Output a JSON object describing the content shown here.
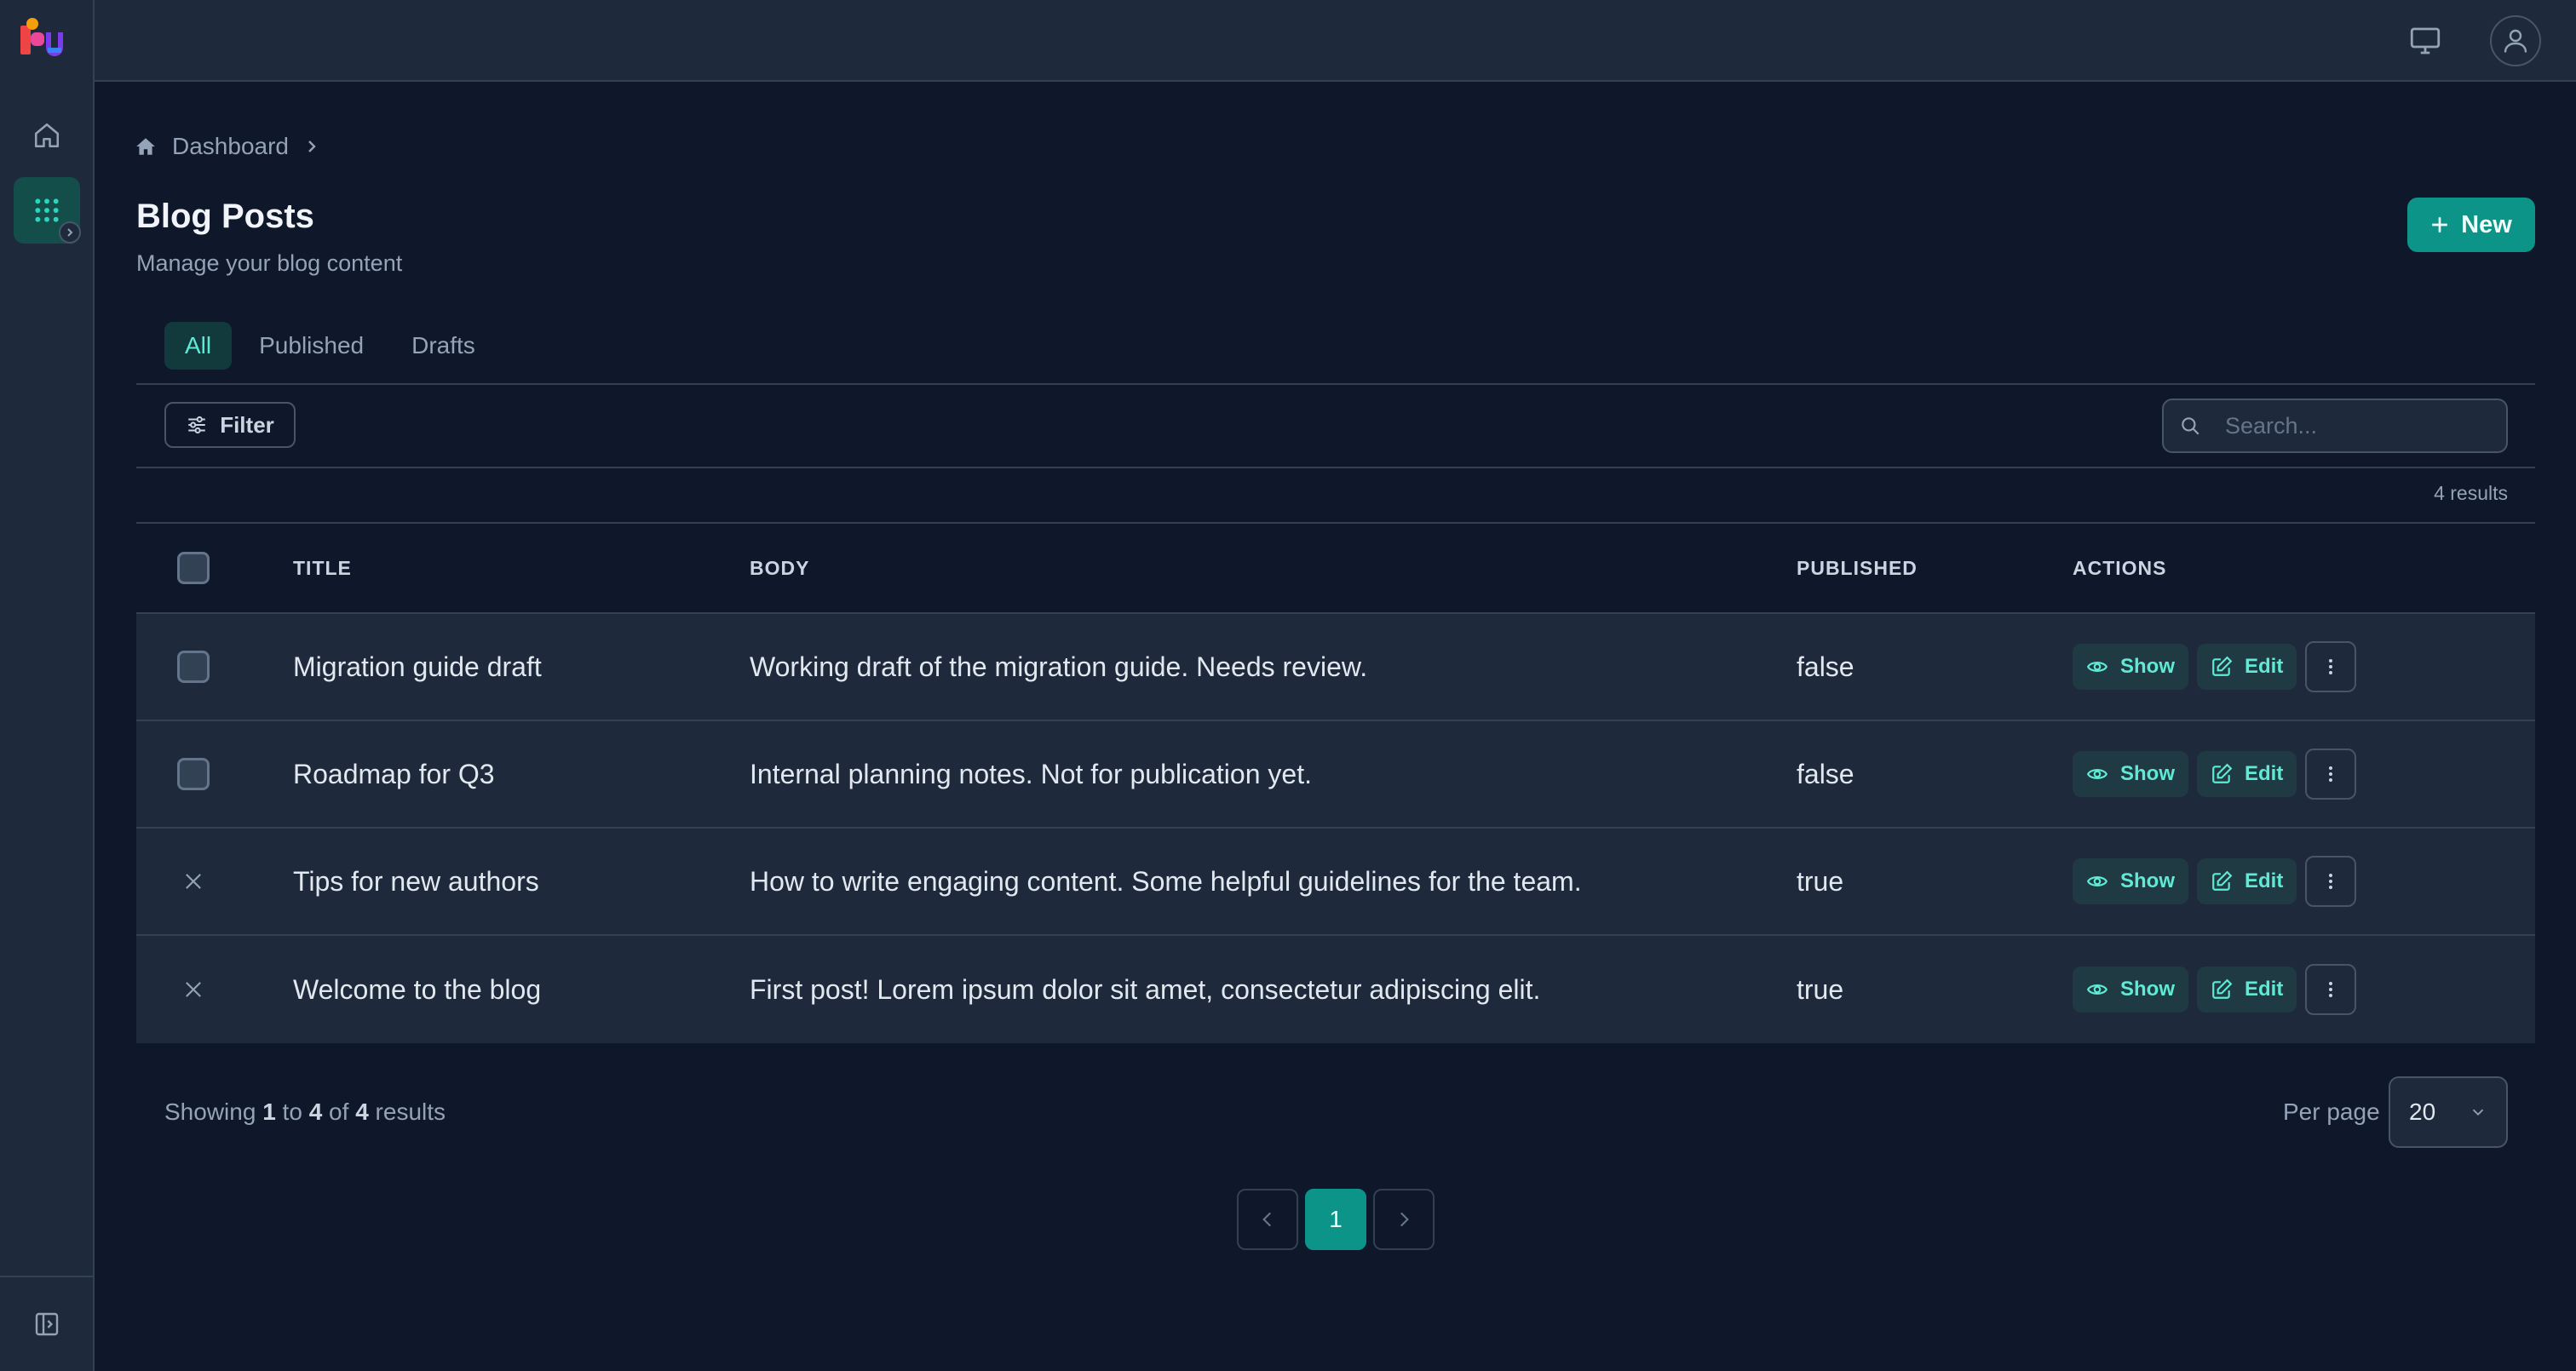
{
  "colors": {
    "accent": "#0d9488",
    "accent_text": "#5eead4",
    "background": "#0f172a",
    "surface": "#1e293b"
  },
  "breadcrumb": {
    "items": [
      "Dashboard"
    ]
  },
  "page": {
    "title": "Blog Posts",
    "subtitle": "Manage your blog content",
    "new_label": "New"
  },
  "tabs": [
    {
      "label": "All",
      "active": true
    },
    {
      "label": "Published",
      "active": false
    },
    {
      "label": "Drafts",
      "active": false
    }
  ],
  "toolbar": {
    "filter_label": "Filter",
    "search_placeholder": "Search...",
    "results_count": "4 results"
  },
  "table": {
    "columns": [
      "TITLE",
      "BODY",
      "PUBLISHED",
      "ACTIONS"
    ],
    "rows": [
      {
        "title": "Migration guide draft",
        "body": "Working draft of the migration guide. Needs review.",
        "published": "false",
        "selector": "checkbox"
      },
      {
        "title": "Roadmap for Q3",
        "body": "Internal planning notes. Not for publication yet.",
        "published": "false",
        "selector": "checkbox"
      },
      {
        "title": "Tips for new authors",
        "body": "How to write engaging content. Some helpful guidelines for the team.",
        "published": "true",
        "selector": "x-icon"
      },
      {
        "title": "Welcome to the blog",
        "body": "First post! Lorem ipsum dolor sit amet, consectetur adipiscing elit.",
        "published": "true",
        "selector": "x-icon"
      }
    ],
    "actions": {
      "show_label": "Show",
      "edit_label": "Edit"
    }
  },
  "footer": {
    "showing_prefix": "Showing",
    "from": "1",
    "to_word": "to",
    "to": "4",
    "of_word": "of",
    "total": "4",
    "suffix": "results",
    "per_page_label": "Per page",
    "per_page_value": "20",
    "current_page": "1"
  }
}
